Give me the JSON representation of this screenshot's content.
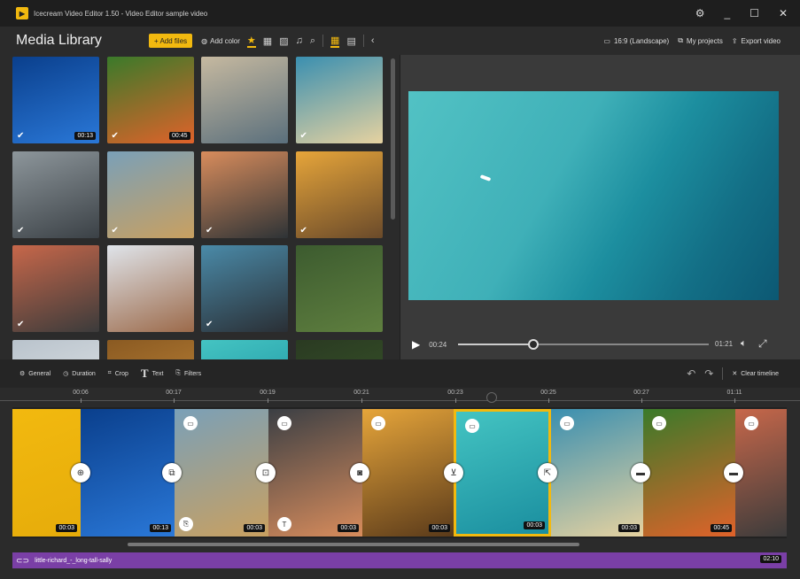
{
  "window": {
    "title": "Icecream Video Editor 1.50 - Video Editor sample video",
    "controls": {
      "settings": "⚙",
      "minimize": "_",
      "maximize": "☐",
      "close": "✕"
    }
  },
  "library": {
    "title": "Media Library",
    "add_files": "+ Add files",
    "add_color": "Add color",
    "filter_icons": [
      "star-icon",
      "video-icon",
      "image-icon",
      "music-icon",
      "search-icon"
    ],
    "view_icons": [
      "grid-large-icon",
      "grid-small-icon",
      "collapse-icon"
    ],
    "items": [
      {
        "duration": "00:13",
        "checked": true,
        "colors": [
          "#0a3f8c",
          "#2a78d8"
        ]
      },
      {
        "duration": "00:45",
        "checked": true,
        "colors": [
          "#3a7a2a",
          "#e0622a"
        ]
      },
      {
        "duration": "",
        "checked": false,
        "colors": [
          "#c6b9a0",
          "#5a6f7c"
        ]
      },
      {
        "duration": "",
        "checked": true,
        "colors": [
          "#3a8fb0",
          "#e6d2a0"
        ]
      },
      {
        "duration": "",
        "checked": true,
        "colors": [
          "#8d969b",
          "#3b4146"
        ]
      },
      {
        "duration": "",
        "checked": true,
        "colors": [
          "#7aa0b8",
          "#c9a060"
        ]
      },
      {
        "duration": "",
        "checked": true,
        "colors": [
          "#d88c5c",
          "#2e3336"
        ]
      },
      {
        "duration": "",
        "checked": true,
        "colors": [
          "#e6a53a",
          "#6a4a2a"
        ]
      },
      {
        "duration": "",
        "checked": true,
        "colors": [
          "#c7674a",
          "#3b3b3b"
        ]
      },
      {
        "duration": "",
        "checked": false,
        "colors": [
          "#dfe4ea",
          "#9c6a4a"
        ]
      },
      {
        "duration": "",
        "checked": true,
        "colors": [
          "#4a8aa8",
          "#2a2f35"
        ]
      },
      {
        "duration": "",
        "checked": false,
        "colors": [
          "#3c5b2f",
          "#5f7f3f"
        ]
      },
      {
        "duration": "",
        "checked": false,
        "colors": [
          "#b9c3cc",
          "#e5e8ea"
        ]
      },
      {
        "duration": "",
        "checked": false,
        "colors": [
          "#8a5a22",
          "#c68a3a"
        ]
      },
      {
        "duration": "",
        "checked": false,
        "colors": [
          "#44c4c2",
          "#1a8e9f"
        ]
      },
      {
        "duration": "",
        "checked": false,
        "colors": [
          "#2a3a22",
          "#3a5a2a"
        ]
      }
    ]
  },
  "preview": {
    "aspect": "16:9 (Landscape)",
    "my_projects": "My projects",
    "export": "Export video",
    "current_time": "00:24",
    "total_time": "01:21",
    "progress": 0.3
  },
  "timeline_toolbar": {
    "general": "General",
    "duration": "Duration",
    "crop": "Crop",
    "text": "Text",
    "filters": "Filters",
    "clear": "Clear timeline"
  },
  "ruler": [
    "00:06",
    "00:17",
    "00:19",
    "00:21",
    "00:23",
    "00:25",
    "00:27",
    "01:11"
  ],
  "clips": [
    {
      "duration": "00:03",
      "colors": [
        "#f2b90f",
        "#e6ac0a"
      ]
    },
    {
      "duration": "00:13",
      "colors": [
        "#0a3f8c",
        "#2a78d8"
      ]
    },
    {
      "duration": "00:03",
      "colors": [
        "#7aa0b8",
        "#c9a060"
      ]
    },
    {
      "duration": "00:03",
      "colors": [
        "#3b3f44",
        "#d88c5c"
      ]
    },
    {
      "duration": "00:03",
      "colors": [
        "#e6a53a",
        "#5a3a1a"
      ]
    },
    {
      "duration": "00:03",
      "colors": [
        "#44c4c2",
        "#1a8e9f"
      ]
    },
    {
      "duration": "00:03",
      "colors": [
        "#3a8fb0",
        "#e6d2a0"
      ]
    },
    {
      "duration": "00:45",
      "colors": [
        "#3a7a2a",
        "#e0622a"
      ]
    },
    {
      "duration": "",
      "colors": [
        "#c7674a",
        "#3b3b3b"
      ]
    }
  ],
  "audio": {
    "name": "little-richard_-_long-tall-sally",
    "duration": "02:10"
  }
}
